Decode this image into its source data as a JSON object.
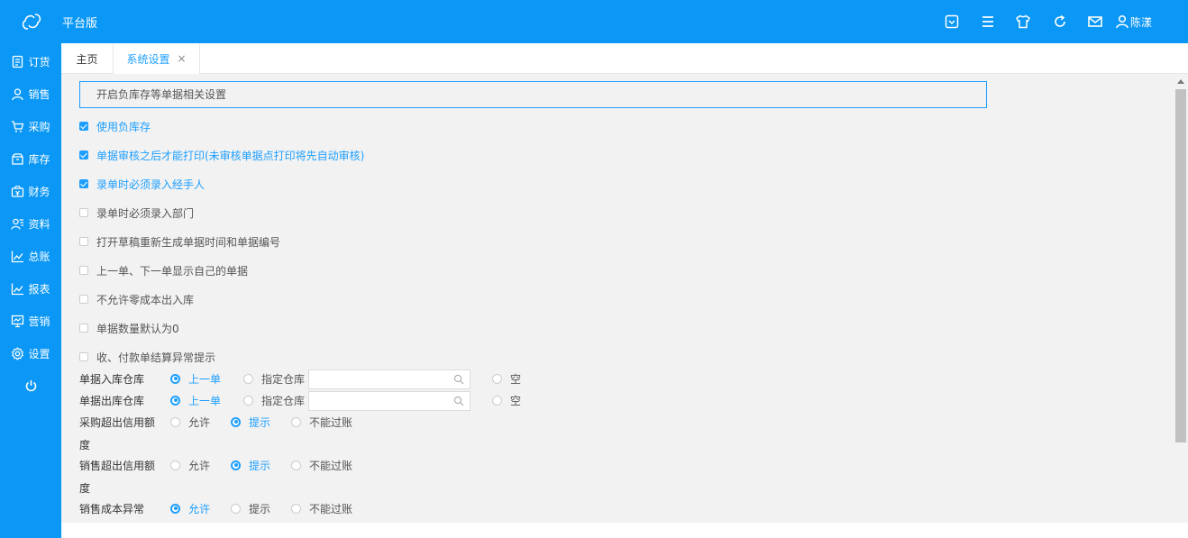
{
  "header": {
    "app_title": "平台版",
    "user_name": "陈漾",
    "icons": [
      "chevron-square-icon",
      "menu-icon",
      "shirt-icon",
      "refresh-icon",
      "mail-icon",
      "user-icon"
    ]
  },
  "sidebar": {
    "items": [
      {
        "label": "订货",
        "icon": "order-icon"
      },
      {
        "label": "销售",
        "icon": "sales-icon"
      },
      {
        "label": "采购",
        "icon": "cart-icon"
      },
      {
        "label": "库存",
        "icon": "inventory-icon"
      },
      {
        "label": "财务",
        "icon": "finance-icon"
      },
      {
        "label": "资料",
        "icon": "contacts-icon"
      },
      {
        "label": "总账",
        "icon": "ledger-chart-icon"
      },
      {
        "label": "报表",
        "icon": "report-chart-icon"
      },
      {
        "label": "营销",
        "icon": "marketing-icon"
      },
      {
        "label": "设置",
        "icon": "gear-icon"
      }
    ],
    "power_icon": "power-icon"
  },
  "tabs": [
    {
      "label": "主页"
    },
    {
      "label": "系统设置",
      "close": "×"
    }
  ],
  "section": {
    "title": "开启负库存等单据相关设置"
  },
  "checkboxes": [
    {
      "label": "使用负库存",
      "checked": true
    },
    {
      "label": "单据审核之后才能打印(未审核单据点打印将先自动审核)",
      "checked": true
    },
    {
      "label": "录单时必须录入经手人",
      "checked": true
    },
    {
      "label": "录单时必须录入部门",
      "checked": false
    },
    {
      "label": "打开草稿重新生成单据时间和单据编号",
      "checked": false
    },
    {
      "label": "上一单、下一单显示自己的单据",
      "checked": false
    },
    {
      "label": "不允许零成本出入库",
      "checked": false
    },
    {
      "label": "单据数量默认为0",
      "checked": false
    },
    {
      "label": "收、付款单结算异常提示",
      "checked": false
    }
  ],
  "warehouse_in": {
    "label": "单据入库仓库",
    "options": [
      "上一单",
      "指定仓库",
      "空"
    ],
    "selected": "上一单",
    "input_value": ""
  },
  "warehouse_out": {
    "label": "单据出库仓库",
    "options": [
      "上一单",
      "指定仓库",
      "空"
    ],
    "selected": "上一单",
    "input_value": ""
  },
  "purchase_credit": {
    "label_line1": "采购超出信用额",
    "label_line2": "度",
    "options": [
      "允许",
      "提示",
      "不能过账"
    ],
    "selected": "提示"
  },
  "sales_credit": {
    "label_line1": "销售超出信用额",
    "label_line2": "度",
    "options": [
      "允许",
      "提示",
      "不能过账"
    ],
    "selected": "提示"
  },
  "sales_cost": {
    "label": "销售成本异常",
    "options": [
      "允许",
      "提示",
      "不能过账"
    ],
    "selected": "允许"
  },
  "colors": {
    "brand": "#0a97f5",
    "accent": "#1e9fff",
    "content_bg": "#f2f2f2"
  }
}
